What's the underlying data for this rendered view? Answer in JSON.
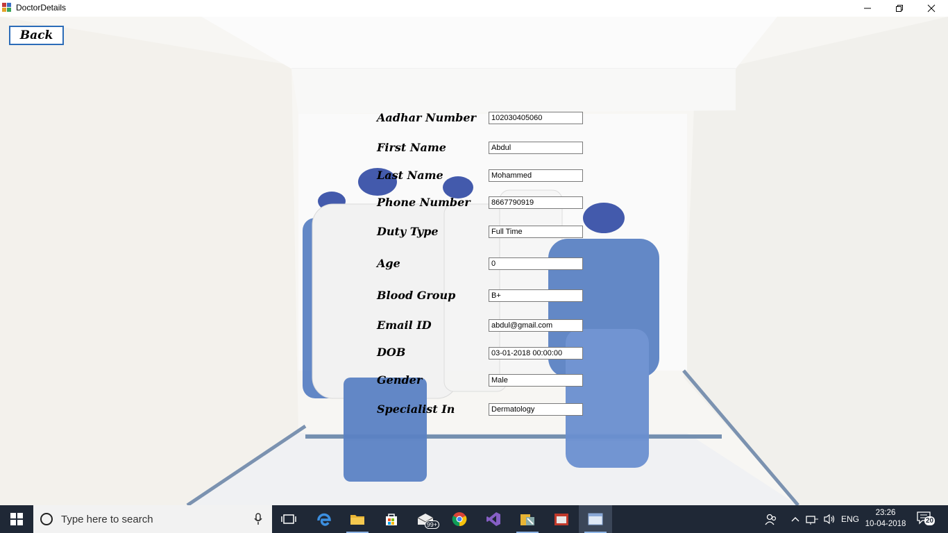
{
  "window": {
    "title": "DoctorDetails"
  },
  "back_button": {
    "label": "Back"
  },
  "form": {
    "fields": [
      {
        "label": "Aadhar Number",
        "value": "102030405060"
      },
      {
        "label": "First Name",
        "value": "Abdul"
      },
      {
        "label": "Last Name",
        "value": "Mohammed"
      },
      {
        "label": "Phone Number",
        "value": "8667790919"
      },
      {
        "label": "Duty Type",
        "value": "Full Time"
      },
      {
        "label": "Age",
        "value": "0"
      },
      {
        "label": "Blood Group",
        "value": "B+"
      },
      {
        "label": "Email ID",
        "value": "abdul@gmail.com"
      },
      {
        "label": "DOB",
        "value": "03-01-2018 00:00:00"
      },
      {
        "label": "Gender",
        "value": "Male"
      },
      {
        "label": "Specialist In",
        "value": "Dermatology"
      }
    ]
  },
  "taskbar": {
    "search_placeholder": "Type here to search",
    "mail_badge": "99+",
    "language": "ENG",
    "time": "23:26",
    "date": "10-04-2018",
    "notification_count": "20",
    "apps": [
      "task-view",
      "edge",
      "file-explorer",
      "store",
      "mail",
      "chrome",
      "visual-studio",
      "tool",
      "office",
      "active-window"
    ]
  },
  "colors": {
    "taskbar": "#1f2836",
    "back_border": "#2b6cb8",
    "scrub_blue": "#5b82c4"
  }
}
